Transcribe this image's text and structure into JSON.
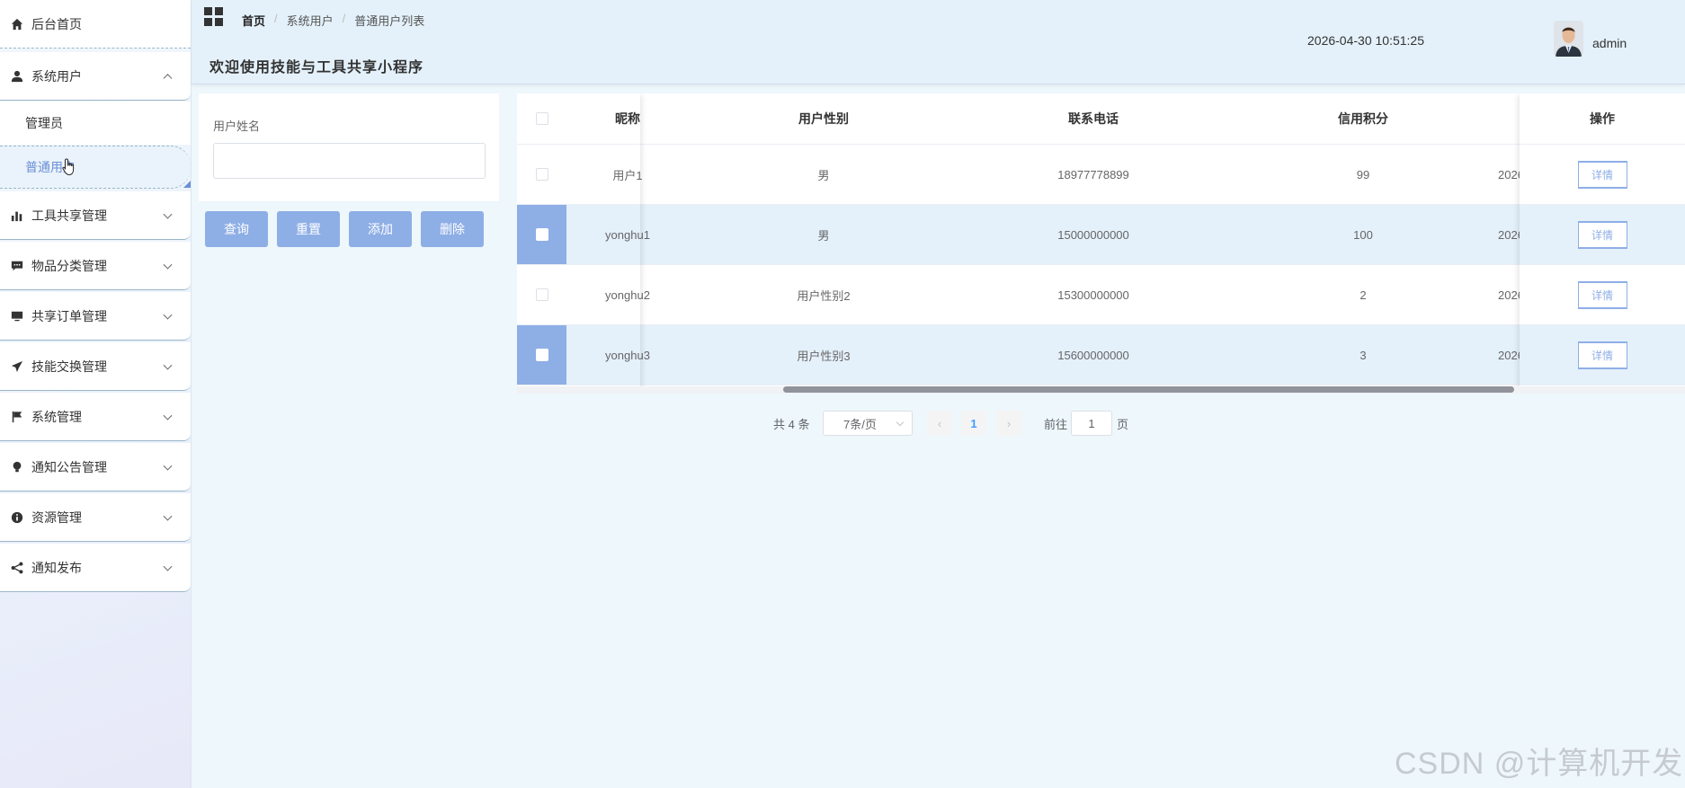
{
  "sidebar": {
    "home": "后台首页",
    "system_users": "系统用户",
    "sub_items": [
      "管理员",
      "普通用户"
    ],
    "groups": [
      "工具共享管理",
      "物品分类管理",
      "共享订单管理",
      "技能交换管理",
      "系统管理",
      "通知公告管理",
      "资源管理",
      "通知发布"
    ]
  },
  "header": {
    "breadcrumb": [
      "首页",
      "系统用户",
      "普通用户列表"
    ],
    "welcome": "欢迎使用技能与工具共享小程序",
    "datetime": "2026-04-30 10:51:25",
    "username": "admin"
  },
  "search": {
    "label": "用户姓名",
    "value": "",
    "buttons": {
      "query": "查询",
      "reset": "重置",
      "add": "添加",
      "delete": "删除"
    }
  },
  "table": {
    "headers": {
      "nickname": "昵称",
      "sex": "用户性别",
      "phone": "联系电话",
      "credit": "信用积分",
      "op": "操作"
    },
    "rows": [
      {
        "nickname": "用户1",
        "sex": "男",
        "phone": "18977778899",
        "credit": "99",
        "extra": "2026",
        "selected": false,
        "op": "详情"
      },
      {
        "nickname": "yonghu1",
        "sex": "男",
        "phone": "15000000000",
        "credit": "100",
        "extra": "2026",
        "selected": true,
        "op": "详情"
      },
      {
        "nickname": "yonghu2",
        "sex": "用户性别2",
        "phone": "15300000000",
        "credit": "2",
        "extra": "2026",
        "selected": false,
        "op": "详情"
      },
      {
        "nickname": "yonghu3",
        "sex": "用户性别3",
        "phone": "15600000000",
        "credit": "3",
        "extra": "2026",
        "selected": true,
        "op": "详情"
      }
    ]
  },
  "pagination": {
    "total": "共 4 条",
    "page_size": "7条/页",
    "current_page": "1",
    "goto_label": "前往",
    "goto_value": "1",
    "page_suffix": "页"
  },
  "watermark": "CSDN @计算机开发",
  "colors": {
    "accent": "#8eaee6",
    "active_page": "#409eff",
    "header_bg": "#e4f1fa"
  },
  "icons": [
    "home-icon",
    "user-icon",
    "bar-chart-icon",
    "comment-icon",
    "monitor-icon",
    "paper-plane-icon",
    "flag-icon",
    "lightbulb-icon",
    "info-icon",
    "share-icon",
    "grid-icon"
  ]
}
